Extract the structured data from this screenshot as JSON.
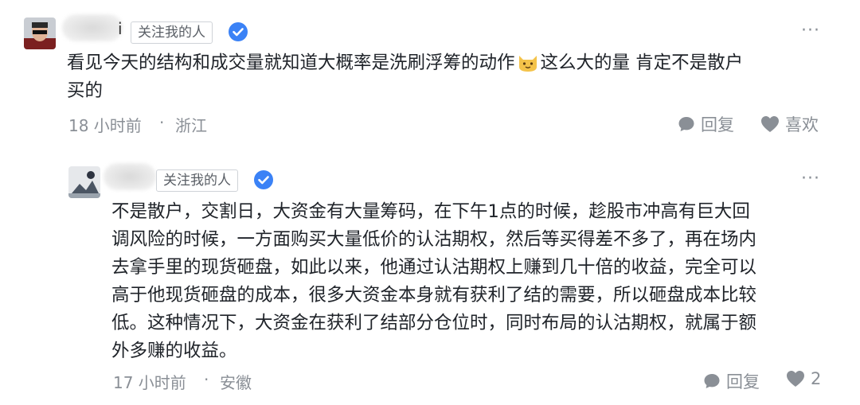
{
  "comments": [
    {
      "follow_label": "关注我的人",
      "name_fragment": "i",
      "text_part1": "看见今天的结构和成交量就知道大概率是洗刷浮筹的动作",
      "emoji_icon": "cat-face-emoji",
      "text_part2": "这么大的量 肯定不是散户",
      "text_line2": "买的",
      "time": "18 小时前",
      "separator": "·",
      "location": "浙江",
      "reply_label": "回复",
      "like_label": "喜欢"
    },
    {
      "follow_label": "关注我的人",
      "lines": [
        "不是散户，交割日，大资金有大量筹码，在下午1点的时候，趁股市冲高有巨大回",
        "调风险的时候，一方面购买大量低价的认沽期权，然后等买得差不多了，再在场内",
        "去拿手里的现货砸盘，如此以来，他通过认沽期权上赚到几十倍的收益，完全可以",
        "高于他现货砸盘的成本，很多大资金本身就有获利了结的需要，所以砸盘成本比较",
        "低。这种情况下，大资金在获利了结部分仓位时，同时布局的认沽期权，就属于额",
        "外多赚的收益。"
      ],
      "time": "17 小时前",
      "separator": "·",
      "location": "安徽",
      "reply_label": "回复",
      "like_count": "2"
    }
  ],
  "colors": {
    "verified_blue": "#3b82f6",
    "meta_gray": "#8a8f96",
    "text": "#1f2329"
  },
  "icons": [
    "verified-badge-icon",
    "more-options-icon",
    "reply-bubble-icon",
    "heart-icon"
  ]
}
